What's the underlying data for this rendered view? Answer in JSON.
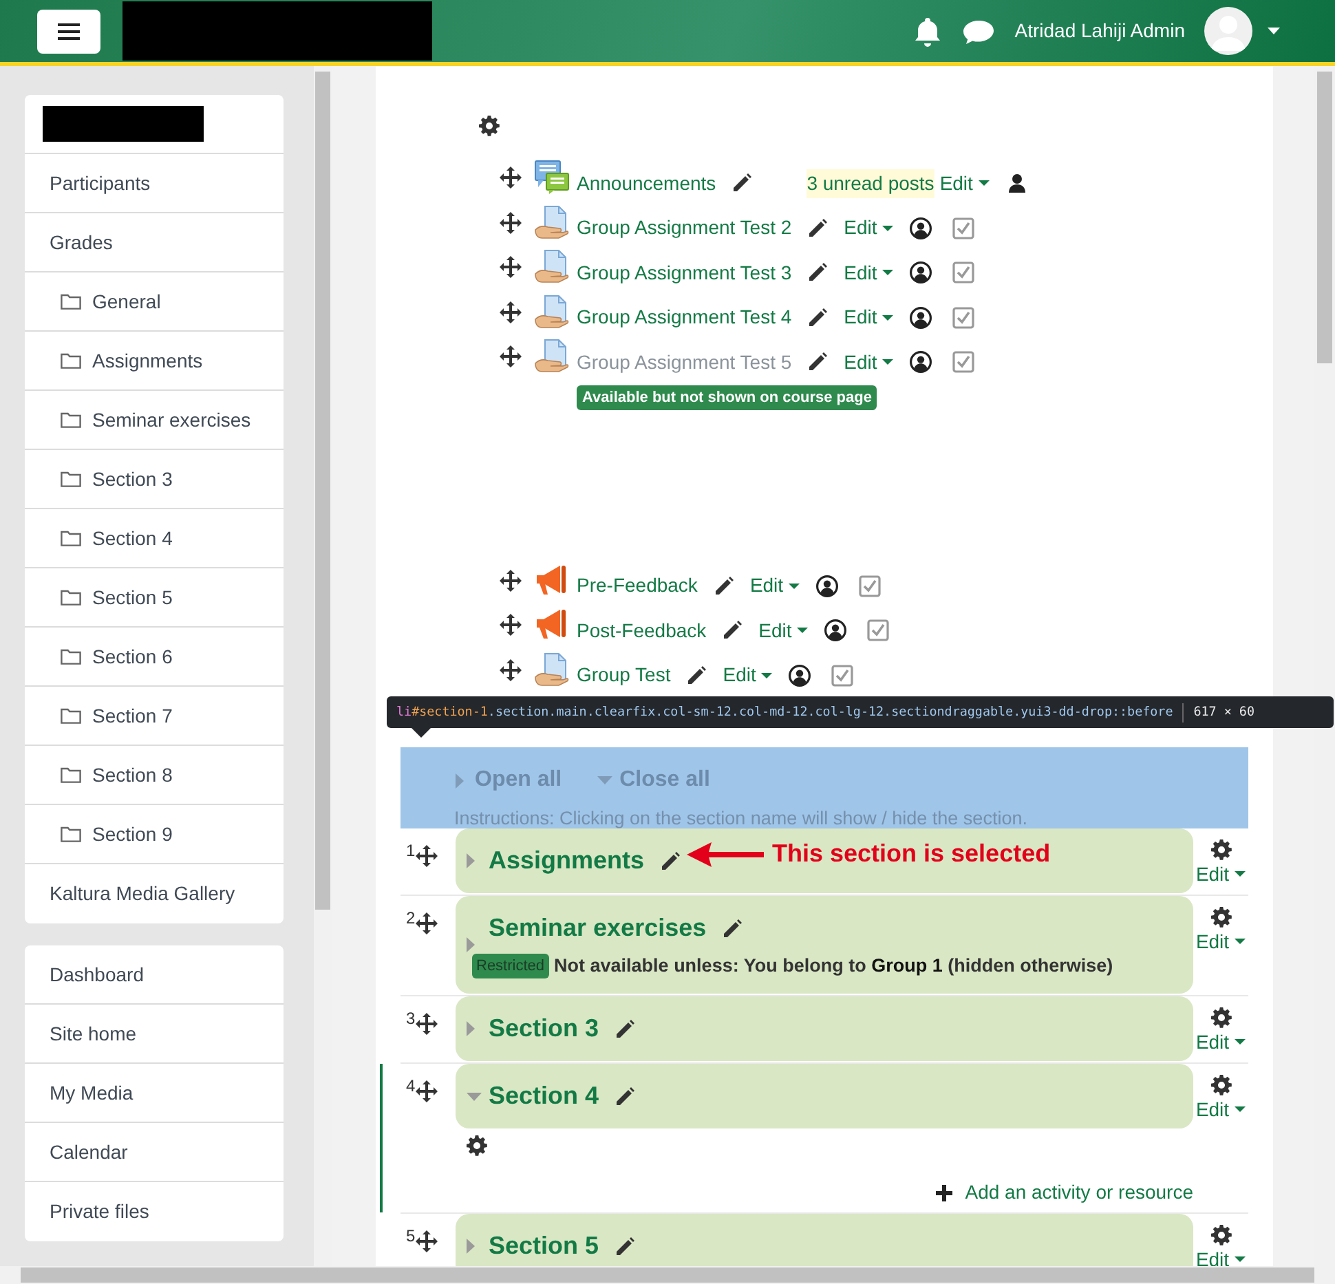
{
  "header": {
    "user_name": "Atridad Lahiji Admin"
  },
  "sidebar": {
    "cards": [
      {
        "items": [
          {
            "label": "Participants",
            "kind": "plain"
          },
          {
            "label": "Grades",
            "kind": "plain"
          },
          {
            "label": "General",
            "kind": "folder"
          },
          {
            "label": "Assignments",
            "kind": "folder"
          },
          {
            "label": "Seminar exercises",
            "kind": "folder"
          },
          {
            "label": "Section 3",
            "kind": "folder"
          },
          {
            "label": "Section 4",
            "kind": "folder"
          },
          {
            "label": "Section 5",
            "kind": "folder"
          },
          {
            "label": "Section 6",
            "kind": "folder"
          },
          {
            "label": "Section 7",
            "kind": "folder"
          },
          {
            "label": "Section 8",
            "kind": "folder"
          },
          {
            "label": "Section 9",
            "kind": "folder"
          },
          {
            "label": "Kaltura Media Gallery",
            "kind": "plain"
          }
        ]
      },
      {
        "items": [
          {
            "label": "Dashboard",
            "kind": "plain"
          },
          {
            "label": "Site home",
            "kind": "plain"
          },
          {
            "label": "My Media",
            "kind": "plain"
          },
          {
            "label": "Calendar",
            "kind": "plain"
          },
          {
            "label": "Private files",
            "kind": "plain"
          }
        ]
      }
    ]
  },
  "activity_groups": [
    {
      "items": [
        {
          "name": "Announcements",
          "kind": "forum",
          "dimmed": false,
          "unread": "3 unread posts",
          "edit": "Edit"
        },
        {
          "name": "Group Assignment Test 2",
          "kind": "assign",
          "dimmed": false,
          "edit": "Edit"
        },
        {
          "name": "Group Assignment Test 3",
          "kind": "assign",
          "dimmed": false,
          "edit": "Edit"
        },
        {
          "name": "Group Assignment Test 4",
          "kind": "assign",
          "dimmed": false,
          "edit": "Edit"
        },
        {
          "name": "Group Assignment Test 5",
          "kind": "assign",
          "dimmed": true,
          "edit": "Edit",
          "badge": "Available but not shown on course page"
        }
      ]
    },
    {
      "items": [
        {
          "name": "Pre-Feedback",
          "kind": "feedback",
          "dimmed": false,
          "edit": "Edit"
        },
        {
          "name": "Post-Feedback",
          "kind": "feedback",
          "dimmed": false,
          "edit": "Edit"
        },
        {
          "name": "Group Test",
          "kind": "assign",
          "dimmed": false,
          "edit": "Edit"
        }
      ]
    }
  ],
  "tooltip": {
    "tag": "li",
    "id": "#section-1",
    "classes": ".section.main.clearfix.col-sm-12.col-md-12.col-lg-12.sectiondraggable.yui3-dd-drop::before",
    "size": "617 × 60"
  },
  "section_controls": {
    "open_all": "Open all",
    "close_all": "Close all",
    "instructions": "Instructions: Clicking on the section name will show / hide the section."
  },
  "sections": [
    {
      "number": "1",
      "name": "Assignments",
      "expanded": false,
      "edit": "Edit",
      "annotation": "This section is selected"
    },
    {
      "number": "2",
      "name": "Seminar exercises",
      "expanded": false,
      "edit": "Edit",
      "restriction": {
        "badge": "Restricted",
        "text": "Not available unless: You belong to **Group 1** (hidden otherwise)"
      }
    },
    {
      "number": "3",
      "name": "Section 3",
      "expanded": false,
      "edit": "Edit"
    },
    {
      "number": "4",
      "name": "Section 4",
      "expanded": true,
      "edit": "Edit",
      "add_activity": "Add an activity or resource"
    },
    {
      "number": "5",
      "name": "Section 5",
      "expanded": false,
      "edit": "Edit"
    }
  ]
}
